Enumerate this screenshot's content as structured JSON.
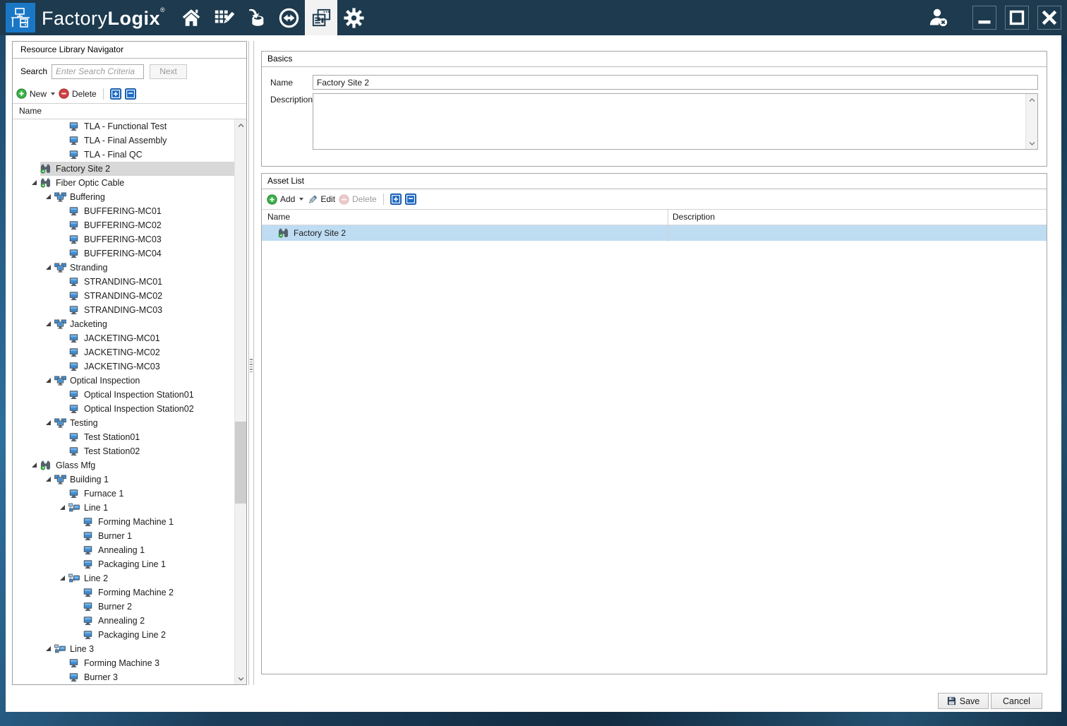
{
  "titlebar": {
    "brand_light": "Factory",
    "brand_bold": "Logix",
    "brand_reg": "®",
    "nav_items": [
      "home",
      "data-grid-edit",
      "database-import",
      "sync",
      "forms",
      "settings"
    ],
    "active_nav": "forms"
  },
  "navigator": {
    "title": "Resource Library Navigator",
    "search_label": "Search",
    "search_placeholder": "Enter Search Criteria",
    "next_button": "Next",
    "new_button": "New",
    "delete_button": "Delete",
    "column_header": "Name",
    "tree": [
      {
        "label": "TLA - Functional Test",
        "level": 3,
        "icon": "machine"
      },
      {
        "label": "TLA - Final Assembly",
        "level": 3,
        "icon": "machine"
      },
      {
        "label": "TLA - Final QC",
        "level": 3,
        "icon": "machine"
      },
      {
        "label": "Factory Site 2",
        "level": 1,
        "icon": "site",
        "selected": true
      },
      {
        "label": "Fiber Optic Cable",
        "level": 1,
        "icon": "site",
        "expanded": true
      },
      {
        "label": "Buffering",
        "level": 2,
        "icon": "group",
        "expanded": true
      },
      {
        "label": "BUFFERING-MC01",
        "level": 3,
        "icon": "machine"
      },
      {
        "label": "BUFFERING-MC02",
        "level": 3,
        "icon": "machine"
      },
      {
        "label": "BUFFERING-MC03",
        "level": 3,
        "icon": "machine"
      },
      {
        "label": "BUFFERING-MC04",
        "level": 3,
        "icon": "machine"
      },
      {
        "label": "Stranding",
        "level": 2,
        "icon": "group",
        "expanded": true
      },
      {
        "label": "STRANDING-MC01",
        "level": 3,
        "icon": "machine"
      },
      {
        "label": "STRANDING-MC02",
        "level": 3,
        "icon": "machine"
      },
      {
        "label": "STRANDING-MC03",
        "level": 3,
        "icon": "machine"
      },
      {
        "label": "Jacketing",
        "level": 2,
        "icon": "group",
        "expanded": true
      },
      {
        "label": "JACKETING-MC01",
        "level": 3,
        "icon": "machine"
      },
      {
        "label": "JACKETING-MC02",
        "level": 3,
        "icon": "machine"
      },
      {
        "label": "JACKETING-MC03",
        "level": 3,
        "icon": "machine"
      },
      {
        "label": "Optical Inspection",
        "level": 2,
        "icon": "group",
        "expanded": true
      },
      {
        "label": "Optical Inspection Station01",
        "level": 3,
        "icon": "machine"
      },
      {
        "label": "Optical Inspection Station02",
        "level": 3,
        "icon": "machine"
      },
      {
        "label": "Testing",
        "level": 2,
        "icon": "group",
        "expanded": true
      },
      {
        "label": "Test Station01",
        "level": 3,
        "icon": "machine"
      },
      {
        "label": "Test Station02",
        "level": 3,
        "icon": "machine"
      },
      {
        "label": "Glass Mfg",
        "level": 1,
        "icon": "site",
        "expanded": true
      },
      {
        "label": "Building 1",
        "level": 2,
        "icon": "group",
        "expanded": true
      },
      {
        "label": "Furnace 1",
        "level": 3,
        "icon": "machine"
      },
      {
        "label": "Line 1",
        "level": 3,
        "icon": "line",
        "expanded": true
      },
      {
        "label": "Forming Machine 1",
        "level": 4,
        "icon": "machine"
      },
      {
        "label": "Burner 1",
        "level": 4,
        "icon": "machine"
      },
      {
        "label": "Annealing 1",
        "level": 4,
        "icon": "machine"
      },
      {
        "label": "Packaging Line 1",
        "level": 4,
        "icon": "machine"
      },
      {
        "label": "Line 2",
        "level": 3,
        "icon": "line",
        "expanded": true
      },
      {
        "label": "Forming Machine 2",
        "level": 4,
        "icon": "machine"
      },
      {
        "label": "Burner 2",
        "level": 4,
        "icon": "machine"
      },
      {
        "label": "Annealing 2",
        "level": 4,
        "icon": "machine"
      },
      {
        "label": "Packaging Line 2",
        "level": 4,
        "icon": "machine"
      },
      {
        "label": "Line 3",
        "level": 2,
        "icon": "line",
        "expanded": true
      },
      {
        "label": "Forming Machine 3",
        "level": 3,
        "icon": "machine"
      },
      {
        "label": "Burner 3",
        "level": 3,
        "icon": "machine"
      }
    ]
  },
  "basics": {
    "title": "Basics",
    "name_label": "Name",
    "name_value": "Factory Site 2",
    "description_label": "Description",
    "description_value": ""
  },
  "asset_list": {
    "title": "Asset List",
    "add_button": "Add",
    "edit_button": "Edit",
    "delete_button": "Delete",
    "columns": [
      "Name",
      "Description"
    ],
    "rows": [
      {
        "name": "Factory Site 2",
        "description": "",
        "icon": "site",
        "selected": true
      }
    ]
  },
  "footer": {
    "save": "Save",
    "cancel": "Cancel"
  },
  "colors": {
    "titlebar_bg": "#1d3a4e",
    "logo_blue": "#1a77c6",
    "tree_selection": "#d8d8d8",
    "row_selection": "#bedcf2",
    "toolbar_blue": "#1f6ac4",
    "add_green": "#3cb149",
    "delete_red": "#d24044"
  }
}
